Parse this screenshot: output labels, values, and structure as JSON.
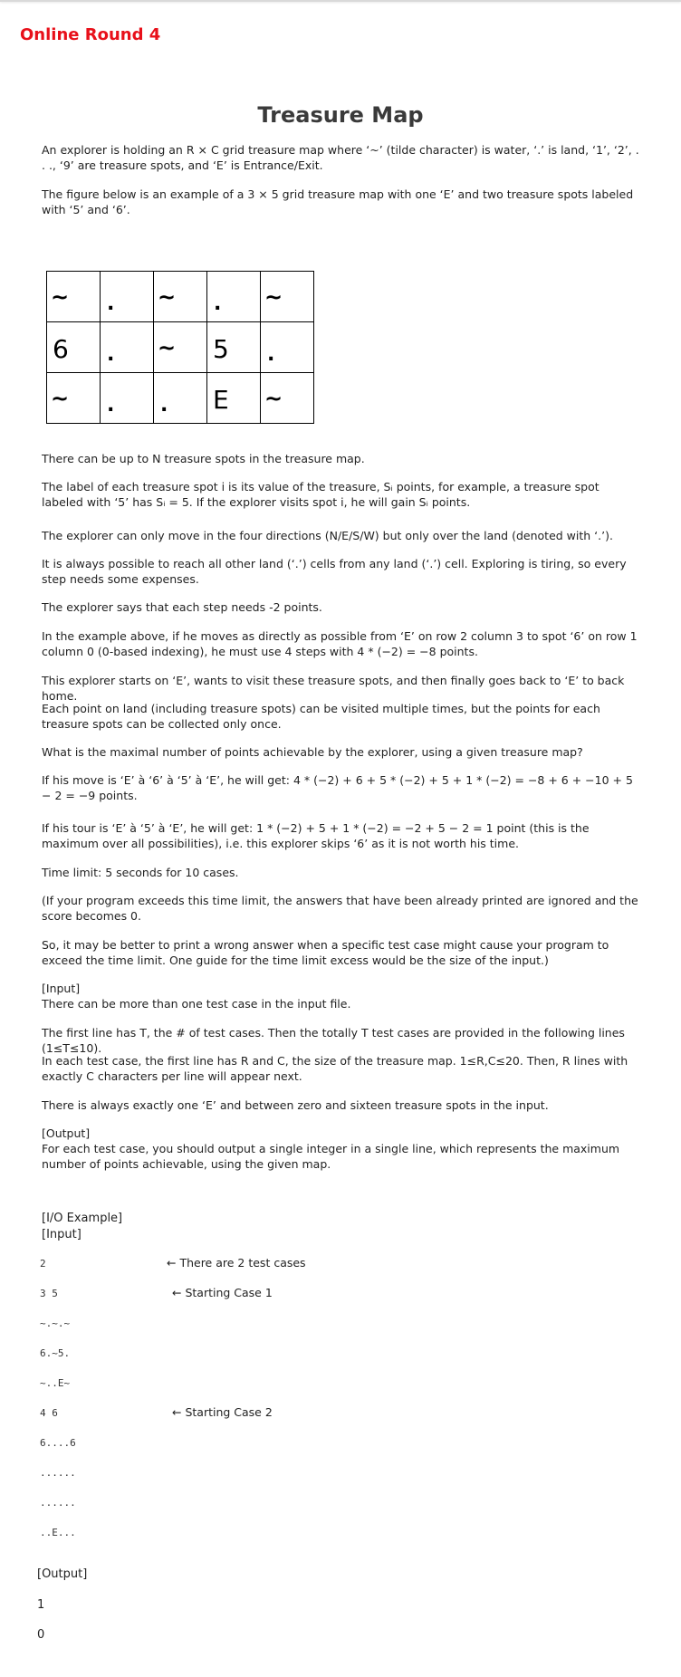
{
  "header": {
    "round_title": "Online Round 4"
  },
  "problem": {
    "title": "Treasure Map",
    "paragraphs": [
      "An explorer is holding an R × C grid treasure map where ‘~’ (tilde character) is water, ‘.’ is land, ‘1’, ‘2’, . . ., ‘9’ are treasure spots, and ‘E’ is Entrance/Exit.",
      "The figure below is an example of a 3 × 5 grid treasure map with one ‘E’ and two treasure spots labeled with ‘5’ and ‘6’."
    ],
    "grid": [
      [
        "~",
        ".",
        "~",
        ".",
        "~"
      ],
      [
        "6",
        ".",
        "~",
        "5",
        "."
      ],
      [
        "~",
        ".",
        ".",
        "E",
        "~"
      ]
    ],
    "body": [
      "There can be up to N treasure spots in the treasure map.",
      "The label of each treasure spot i is its value of the treasure, Sᵢ points, for example, a treasure spot labeled with ‘5’ has Sᵢ = 5. If the explorer visits spot i, he will gain Sᵢ points.",
      "The explorer can only move in the four directions (N/E/S/W) but only over the land (denoted with ‘.’).",
      "It is always possible to reach all other land (‘.’) cells from any land (‘.’) cell. Exploring is tiring, so every step needs some expenses.",
      "The explorer says that each step needs -2 points.",
      "In the example above, if he moves as directly as possible from ‘E’ on row 2 column 3 to spot ‘6’ on row 1 column 0 (0-based indexing), he must use 4 steps with 4 * (−2) = −8 points.",
      "This explorer starts on ‘E’, wants to visit these treasure spots, and then finally goes back to ‘E’ to back home.",
      "Each point on land (including treasure spots) can be visited multiple times, but the points for each treasure spots can be collected only once.",
      "What is the maximal number of points achievable by the explorer, using a given treasure map?",
      "If his move is ‘E’ à ‘6’ à ‘5’ à ‘E’, he will get: 4 * (−2) + 6 + 5 * (−2) + 5 + 1 * (−2) = −8 + 6 + −10 + 5 − 2 = −9 points.",
      "If his tour is ‘E’ à ‘5’ à ‘E’, he will get: 1 * (−2) + 5 + 1 * (−2) = −2 + 5 − 2 = 1 point (this is the maximum over all possibilities), i.e. this explorer skips ‘6’ as it is not worth his time.",
      "Time limit: 5 seconds for 10 cases.",
      "(If your program exceeds this time limit, the answers that have been already printed are ignored and the score becomes 0.",
      "So, it may be better to print a wrong answer when a specific test case might cause your program to exceed the time limit. One guide for the time limit excess would be the size of the input.)",
      "[Input]\nThere can be more than one test case in the input file.",
      "The first line has T, the # of test cases. Then the totally T test cases are provided in the following lines (1≤T≤10).",
      "In each test case, the first line has R and C, the size of the treasure map. 1≤R,C≤20. Then, R lines with exactly C characters per line will appear next.",
      "There is always exactly one ‘E’ and between zero and sixteen treasure spots in the input.",
      "[Output]\nFor each test case, you should output a single integer in a single line, which represents the maximum number of points achievable, using the given map."
    ]
  },
  "example": {
    "io_label": "[I/O Example]",
    "input_label": "[Input]",
    "input_lines": [
      "2",
      "3 5",
      "~.~.~",
      "6.~5.",
      "~..E~",
      "4 6",
      "6....6",
      "......",
      "......",
      "..E..."
    ],
    "notes": [
      "← There are 2 test cases",
      "← Starting Case 1",
      "← Starting Case 2"
    ],
    "output_label": "[Output]",
    "output_lines": [
      "1",
      "0"
    ]
  }
}
